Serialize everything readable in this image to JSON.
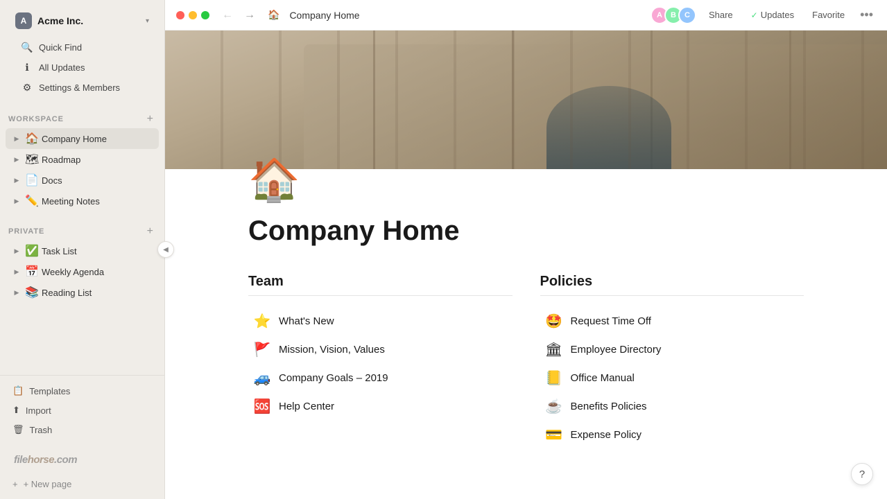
{
  "app": {
    "title": "Company Home",
    "icon": "🏠"
  },
  "titlebar": {
    "back_label": "←",
    "forward_label": "→",
    "page_icon": "🏠",
    "page_title": "Company Home",
    "share_label": "Share",
    "updates_label": "Updates",
    "favorite_label": "Favorite",
    "more_label": "•••"
  },
  "sidebar": {
    "workspace_name": "Acme Inc.",
    "workspace_chevron": "▾",
    "nav_items": [
      {
        "icon": "🔍",
        "label": "Quick Find"
      },
      {
        "icon": "ℹ",
        "label": "All Updates"
      },
      {
        "icon": "⚙",
        "label": "Settings & Members"
      }
    ],
    "workspace_label": "WORKSPACE",
    "workspace_items": [
      {
        "icon": "🏠",
        "label": "Company Home",
        "active": true
      },
      {
        "icon": "🗺",
        "label": "Roadmap"
      },
      {
        "icon": "📄",
        "label": "Docs"
      },
      {
        "icon": "✏️",
        "label": "Meeting Notes"
      }
    ],
    "private_label": "PRIVATE",
    "private_items": [
      {
        "icon": "✅",
        "label": "Task List"
      },
      {
        "icon": "📅",
        "label": "Weekly Agenda"
      },
      {
        "icon": "📚",
        "label": "Reading List"
      }
    ],
    "bottom_items": [
      {
        "icon": "📋",
        "label": "Templates"
      },
      {
        "icon": "⬆",
        "label": "Import"
      },
      {
        "icon": "🗑",
        "label": "Trash"
      }
    ],
    "new_page_label": "+ New page",
    "collapse_icon": "◀",
    "logo": "filehorse.com"
  },
  "page": {
    "emoji": "🏠",
    "title": "Company Home",
    "team_section": {
      "title": "Team",
      "links": [
        {
          "emoji": "⭐",
          "label": "What's New"
        },
        {
          "emoji": "🚩",
          "label": "Mission, Vision, Values"
        },
        {
          "emoji": "🚙",
          "label": "Company Goals – 2019"
        },
        {
          "emoji": "🆘",
          "label": "Help Center"
        }
      ]
    },
    "policies_section": {
      "title": "Policies",
      "links": [
        {
          "emoji": "🤩",
          "label": "Request Time Off"
        },
        {
          "emoji": "🏛",
          "label": "Employee Directory"
        },
        {
          "emoji": "📒",
          "label": "Office Manual"
        },
        {
          "emoji": "☕",
          "label": "Benefits Policies"
        },
        {
          "emoji": "💳",
          "label": "Expense Policy"
        }
      ]
    }
  },
  "help": {
    "label": "?"
  }
}
